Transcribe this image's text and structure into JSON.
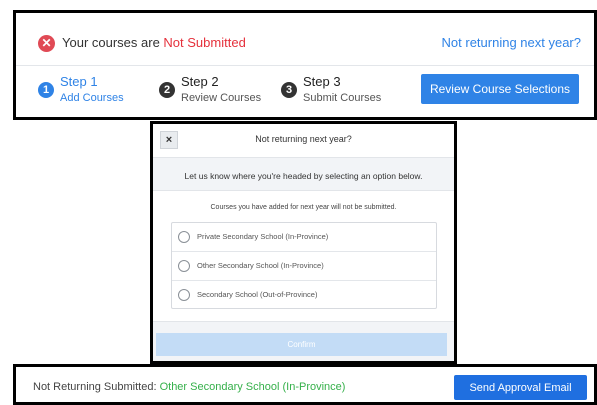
{
  "status": {
    "icon": "x-circle-icon",
    "prefix": "Your courses are ",
    "state": "Not Submitted",
    "link_label": "Not returning next year?"
  },
  "steps": [
    {
      "number": "1",
      "title": "Step 1",
      "subtitle": "Add Courses",
      "active": true
    },
    {
      "number": "2",
      "title": "Step 2",
      "subtitle": "Review Courses",
      "active": false
    },
    {
      "number": "3",
      "title": "Step 3",
      "subtitle": "Submit Courses",
      "active": false
    }
  ],
  "review_button_label": "Review Course Selections",
  "modal": {
    "close_label": "×",
    "title": "Not returning next year?",
    "prompt": "Let us know where you're headed by selecting an option below.",
    "note": "Courses you have added for next year will not be submitted.",
    "options": [
      {
        "label": "Private Secondary School (In-Province)"
      },
      {
        "label": "Other Secondary School (In-Province)"
      },
      {
        "label": "Secondary School (Out-of-Province)"
      }
    ],
    "confirm_label": "Confirm"
  },
  "bottom": {
    "prefix": "Not Returning Submitted: ",
    "value": "Other Secondary School (In-Province)",
    "email_button_label": "Send Approval Email"
  },
  "colors": {
    "primary_blue": "#2f83e6",
    "error_red": "#e5313c",
    "success_green": "#35b04a"
  }
}
